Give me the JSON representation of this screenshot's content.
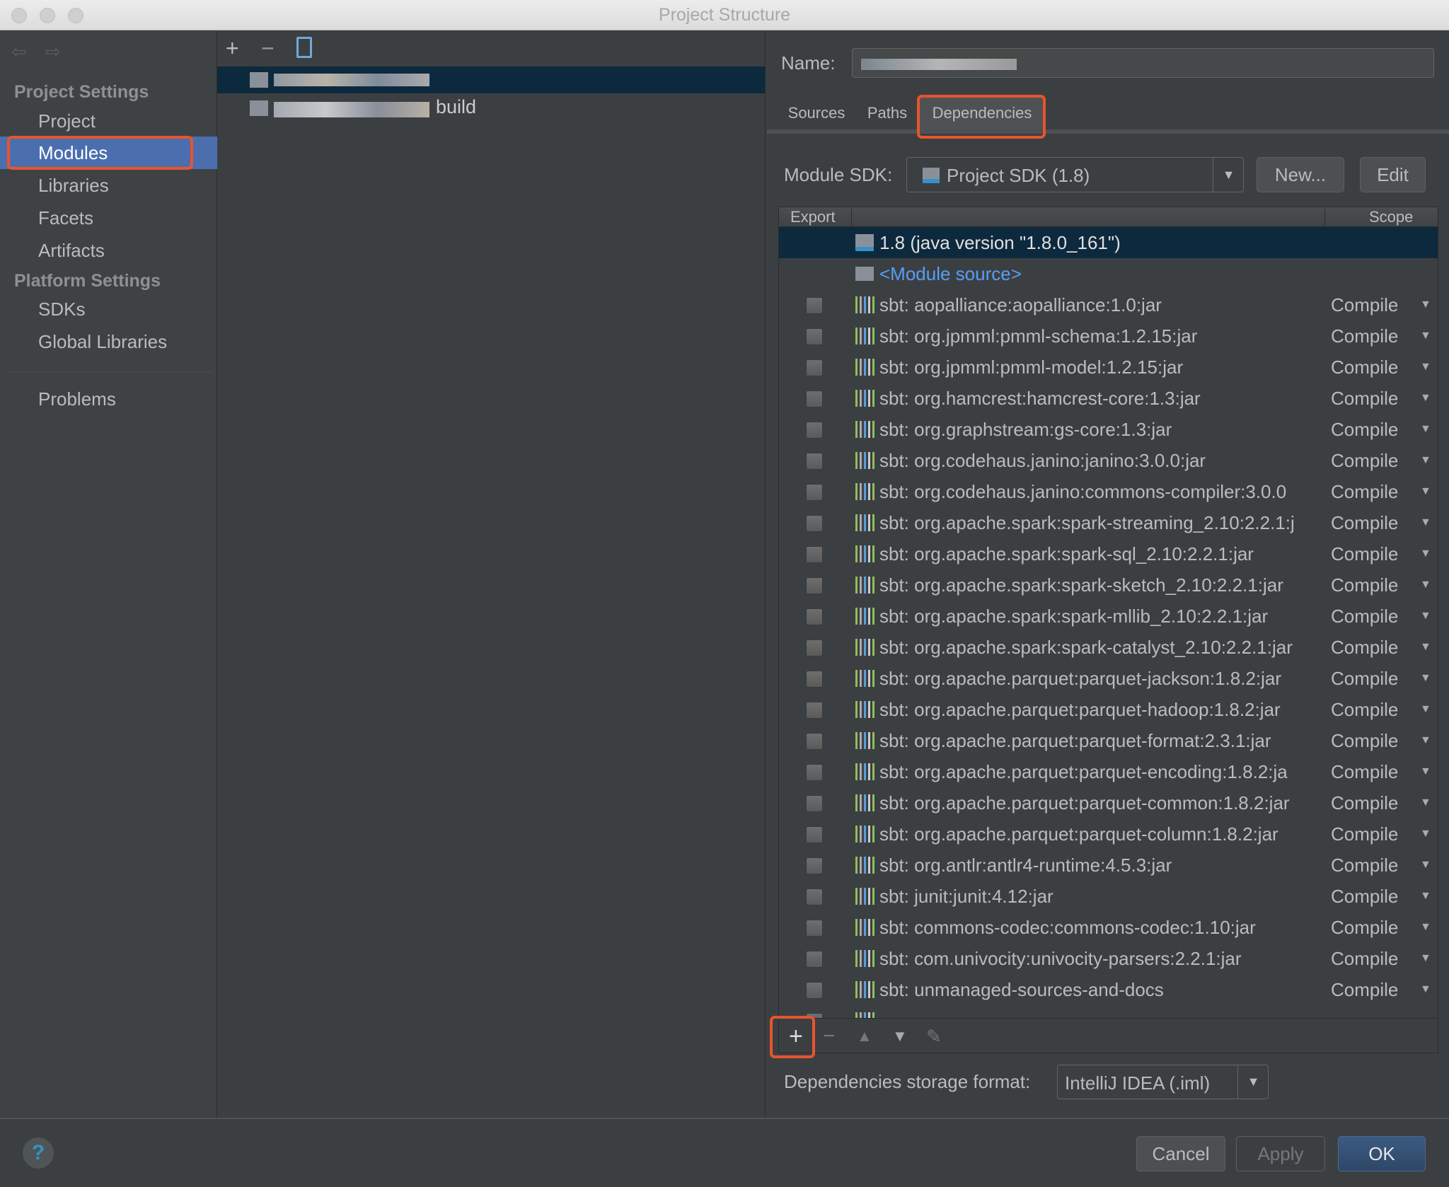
{
  "window": {
    "title": "Project Structure"
  },
  "sidebar": {
    "project_settings": "Project Settings",
    "items": [
      {
        "label": "Project"
      },
      {
        "label": "Modules"
      },
      {
        "label": "Libraries"
      },
      {
        "label": "Facets"
      },
      {
        "label": "Artifacts"
      }
    ],
    "platform_settings": "Platform Settings",
    "platform_items": [
      {
        "label": "SDKs"
      },
      {
        "label": "Global Libraries"
      }
    ],
    "problems": "Problems"
  },
  "modules_tree": {
    "items": [
      {
        "label": ""
      },
      {
        "label": "build"
      }
    ]
  },
  "module": {
    "name_label": "Name:",
    "name_value": "",
    "tabs": [
      {
        "label": "Sources"
      },
      {
        "label": "Paths"
      },
      {
        "label": "Dependencies"
      }
    ],
    "active_tab": "Dependencies",
    "sdk_label": "Module SDK:",
    "sdk_value": "Project SDK (1.8)",
    "new_button": "New...",
    "edit_button": "Edit",
    "columns": {
      "export": "Export",
      "scope": "Scope"
    },
    "sdk_row": "1.8 (java version \"1.8.0_161\")",
    "source_row": "<Module source>",
    "dependencies": [
      {
        "name": "sbt: aopalliance:aopalliance:1.0:jar",
        "scope": "Compile"
      },
      {
        "name": "sbt: org.jpmml:pmml-schema:1.2.15:jar",
        "scope": "Compile"
      },
      {
        "name": "sbt: org.jpmml:pmml-model:1.2.15:jar",
        "scope": "Compile"
      },
      {
        "name": "sbt: org.hamcrest:hamcrest-core:1.3:jar",
        "scope": "Compile"
      },
      {
        "name": "sbt: org.graphstream:gs-core:1.3:jar",
        "scope": "Compile"
      },
      {
        "name": "sbt: org.codehaus.janino:janino:3.0.0:jar",
        "scope": "Compile"
      },
      {
        "name": "sbt: org.codehaus.janino:commons-compiler:3.0.0",
        "scope": "Compile"
      },
      {
        "name": "sbt: org.apache.spark:spark-streaming_2.10:2.2.1:j",
        "scope": "Compile"
      },
      {
        "name": "sbt: org.apache.spark:spark-sql_2.10:2.2.1:jar",
        "scope": "Compile"
      },
      {
        "name": "sbt: org.apache.spark:spark-sketch_2.10:2.2.1:jar",
        "scope": "Compile"
      },
      {
        "name": "sbt: org.apache.spark:spark-mllib_2.10:2.2.1:jar",
        "scope": "Compile"
      },
      {
        "name": "sbt: org.apache.spark:spark-catalyst_2.10:2.2.1:jar",
        "scope": "Compile"
      },
      {
        "name": "sbt: org.apache.parquet:parquet-jackson:1.8.2:jar",
        "scope": "Compile"
      },
      {
        "name": "sbt: org.apache.parquet:parquet-hadoop:1.8.2:jar",
        "scope": "Compile"
      },
      {
        "name": "sbt: org.apache.parquet:parquet-format:2.3.1:jar",
        "scope": "Compile"
      },
      {
        "name": "sbt: org.apache.parquet:parquet-encoding:1.8.2:ja",
        "scope": "Compile"
      },
      {
        "name": "sbt: org.apache.parquet:parquet-common:1.8.2:jar",
        "scope": "Compile"
      },
      {
        "name": "sbt: org.apache.parquet:parquet-column:1.8.2:jar",
        "scope": "Compile"
      },
      {
        "name": "sbt: org.antlr:antlr4-runtime:4.5.3:jar",
        "scope": "Compile"
      },
      {
        "name": "sbt: junit:junit:4.12:jar",
        "scope": "Compile"
      },
      {
        "name": "sbt: commons-codec:commons-codec:1.10:jar",
        "scope": "Compile"
      },
      {
        "name": "sbt: com.univocity:univocity-parsers:2.2.1:jar",
        "scope": "Compile"
      },
      {
        "name": "sbt: unmanaged-sources-and-docs",
        "scope": "Compile"
      }
    ],
    "storage_label": "Dependencies storage format:",
    "storage_value": "IntelliJ IDEA (.iml)"
  },
  "footer": {
    "help": "?",
    "cancel": "Cancel",
    "apply": "Apply",
    "ok": "OK"
  },
  "colors": {
    "selection": "#4b6eaf",
    "row_selection": "#0d293e",
    "highlight": "#e8542f",
    "link": "#589df6"
  }
}
